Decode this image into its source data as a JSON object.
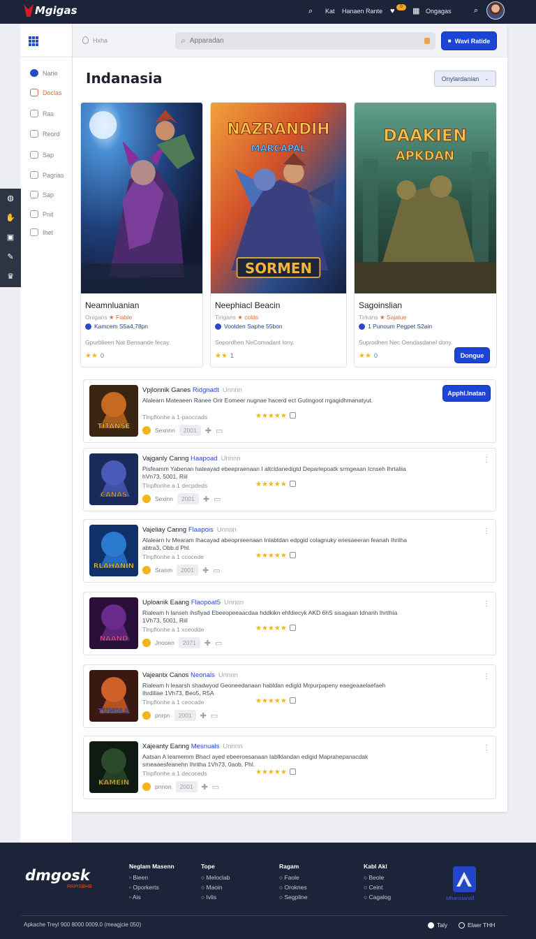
{
  "app": {
    "logo_text": "Mgigas"
  },
  "topbar": {
    "nav": [
      "Kat",
      "Hanaen",
      "Rante"
    ],
    "notif_count": "0",
    "profile_label": "Ongagas"
  },
  "sidebar": {
    "items": [
      {
        "label": "Narie",
        "icon": "shield-icon",
        "active": true
      },
      {
        "label": "Doclas",
        "icon": "calendar-icon",
        "highlight": true
      },
      {
        "label": "Ras",
        "icon": "car-icon"
      },
      {
        "label": "Reord",
        "icon": "home-icon"
      },
      {
        "label": "Sap",
        "icon": "menu-icon"
      },
      {
        "label": "Pagrias",
        "icon": "puzzle-icon"
      },
      {
        "label": "Sap",
        "icon": "clock-icon"
      },
      {
        "label": "Pnit",
        "icon": "grid-icon"
      },
      {
        "label": "Ihet",
        "icon": "help-icon"
      }
    ]
  },
  "dock": {
    "icons": [
      "gamepad-icon",
      "hand-icon",
      "tag-icon",
      "edit-icon",
      "trophy-icon"
    ]
  },
  "header": {
    "hint": "Hxha",
    "search_placeholder": "Apparadan",
    "cta_label": "Wavi Ratide"
  },
  "main": {
    "title": "Indanasia",
    "sort_label": "Onylardanian"
  },
  "featured": [
    {
      "title": "Neamnluanian",
      "meta_a": "Onigans",
      "meta_b": "Fiable",
      "dev": "Kamcem S5a4,78pn",
      "desc": "Gpurblieen Nat Bensande fecay.",
      "rating": "0",
      "stars": 2,
      "art_text": "",
      "art_subtext": "",
      "art_label": ""
    },
    {
      "title": "Neephiacl Beacin",
      "meta_a": "Tirigans",
      "meta_b": "colds",
      "dev": "Voolden Saphe 55bon",
      "desc": "Sepordhen NeComadant lony.",
      "rating": "1",
      "stars": 2,
      "art_text": "NAZRANDIH",
      "art_subtext": "MARCAPAL",
      "art_label": "SORMEN"
    },
    {
      "title": "Sagoinslian",
      "meta_a": "Tirkans",
      "meta_b": "Sajalue",
      "dev": "1 Punoum Pegpet S2ain",
      "desc": "Suprodhen Nec Oendasdanel dony.",
      "rating": "0",
      "stars": 2,
      "art_text": "DAAKIEN",
      "art_subtext": "APKDAN",
      "art_label": "",
      "button": "Dongue"
    }
  ],
  "list": [
    {
      "title_a": "Vpjlonnik Ganes",
      "title_b": "Ridgnadt",
      "title_c": "Unnnn",
      "desc": "Alalearn Mateaeen Ranee Orir Eomeer nugnae hacerd ect Gutingoot rrgagidhmanatyut.",
      "sub": "Tlnpflonhe a 1-paoccads",
      "vendor": "Sexnnn",
      "year": "2001",
      "stars": 5,
      "button": "Apphl.lnatan",
      "thumb_text": "TITANSE"
    },
    {
      "title_a": "Vajganly Canng",
      "title_b": "Haapoad",
      "title_c": "Unnnn",
      "desc": "Pisfeamm Yabenan hateayad ebeepraenaan I altcldanedigtd Deparlepoatk srmgeaan Icnseh Ihrtaliia hVn73, 5001, Riil",
      "sub": "Tlnpflonhe a 1 decpdeds",
      "vendor": "Sexinn",
      "year": "2001",
      "stars": 5,
      "thumb_text": "CANAS"
    },
    {
      "title_a": "Vajeliay Canng",
      "title_b": "Flaapois",
      "title_c": "Unnnn",
      "desc": "Alalearn Iv Mearam Ihacayad abeoprseenaan Iniabtdan edpgid colagnuky eriesaeeran feanah Ihriiha abtra3, Obb.d Phl.",
      "sub": "Tlnpflonhe a 1 ccocede",
      "vendor": "Sranm",
      "year": "2001",
      "stars": 5,
      "thumb_text": "RLAHANIN"
    },
    {
      "title_a": "Uploanik Eaang",
      "title_b": "Flaopoat5",
      "title_c": "Unnnn",
      "desc": "Rialeam h lanseh ihsfiyad Ebeeopeeaacdaa hddkikn ehfdiecyk AKD 6hS sisagaan Idnanh Ihrtlhia 1Vh73, 5001, Riil",
      "sub": "Tlnpflonhe a 1 xceodde",
      "vendor": "Jnooen",
      "year": "2071",
      "stars": 5,
      "thumb_text": "NAAND"
    },
    {
      "title_a": "Vajeantx Canos",
      "title_b": "Neonals",
      "title_c": "Unnnn",
      "desc": "Rialeam h leaarsh shadwyod Geoneedanaan habldan edigld Mrpurpapeny eaegeaaelaefaeh Ihrdiliae 1Vh73, Beo5, R5A",
      "sub": "Tlnpflonhe a 1 ceocade",
      "vendor": "pnrpn",
      "year": "2001",
      "stars": 5,
      "thumb_text": "TUNDLS"
    },
    {
      "title_a": "Xajeanty Eanng",
      "title_b": "Mesnuals",
      "title_c": "Unnnn",
      "desc": "Aatsan A Ieamemm Bhacl ayed ebeeroesanaan Iablklandan edigid Maprahepanacdak smeaaesfeanehn Ihritha 1Vh73, 0aob, Phl.",
      "sub": "Tlnpflonhe a 1 decoceds",
      "vendor": "pnnon",
      "year": "2001",
      "stars": 5,
      "thumb_text": "KAMEIN"
    }
  ],
  "footer": {
    "logo": "dmgosk",
    "logo_sub": "RRPISBHB",
    "columns": [
      {
        "heading": "Neglam Masenn",
        "items": [
          "Bieen",
          "Oporkerts",
          "Ais"
        ]
      },
      {
        "heading": "Tope",
        "items": [
          "Meloclab",
          "Maoin",
          "Ivlis"
        ]
      },
      {
        "heading": "Ragam",
        "items": [
          "Faole",
          "Oroknes",
          "Segpline"
        ]
      },
      {
        "heading": "Kabl Akl",
        "items": [
          "Beole",
          "Ceint",
          "Cagalog"
        ]
      }
    ],
    "badge_label": "Mhanstanall",
    "copyright": "Apkache Treyl 900 8000 0009.0 (meagjcie 050)",
    "right_a": "Taly",
    "right_b": "Elaer THH"
  },
  "colors": {
    "accent": "#1e44d6",
    "topbar": "#1b2439",
    "star": "#f3b51a",
    "highlight": "#e2693b"
  }
}
